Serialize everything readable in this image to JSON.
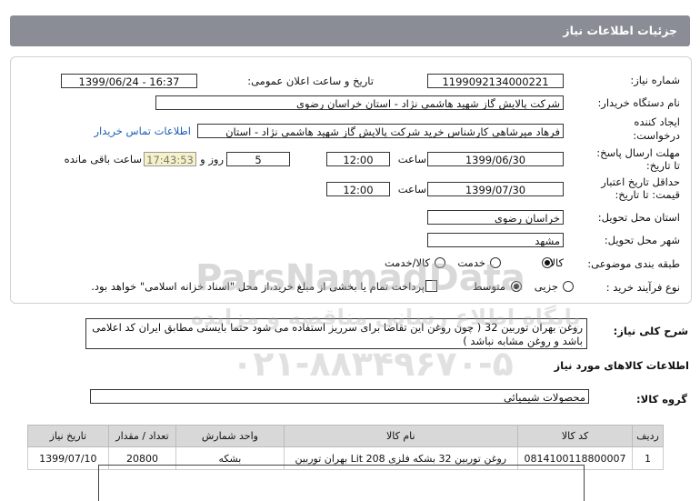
{
  "header": {
    "title": "جزئیات اطلاعات نیاز"
  },
  "form": {
    "need_number": {
      "label": "شماره نیاز:",
      "value": "1199092134000221"
    },
    "announce_datetime": {
      "label": "تاریخ و ساعت اعلان عمومی:",
      "value": "1399/06/24 - 16:37"
    },
    "buyer": {
      "label": "نام دستگاه خریدار:",
      "value": "شرکت پالایش گاز شهید هاشمی نژاد - استان خراسان رضوی"
    },
    "creator": {
      "label1": "ایجاد کننده",
      "label2": "درخواست:",
      "value": "فرهاد میرشاهی کارشناس خرید شرکت پالایش گاز شهید هاشمی نژاد - استان",
      "contact_link": "اطلاعات تماس خریدار"
    },
    "reply_deadline": {
      "label1": "مهلت ارسال پاسخ:",
      "label2": "تا تاریخ:",
      "date": "1399/06/30",
      "time_label": "ساعت",
      "time": "12:00",
      "days": "5",
      "days_label": "روز و",
      "remaining": "17:43:53",
      "remaining_label": "ساعت باقی مانده"
    },
    "price_validity": {
      "label1": "حداقل تاریخ اعتبار",
      "label2": "قیمت: تا تاریخ:",
      "date": "1399/07/30",
      "time_label": "ساعت",
      "time": "12:00"
    },
    "delivery_province": {
      "label": "استان محل تحویل:",
      "value": "خراسان رضوی"
    },
    "delivery_city": {
      "label": "شهر محل تحویل:",
      "value": "مشهد"
    },
    "category": {
      "label": "طبقه بندی موضوعی:",
      "options": [
        "کالا",
        "خدمت",
        "کالا/خدمت"
      ],
      "selected": "کالا"
    },
    "purchase_process": {
      "label": "نوع فرآیند خرید :",
      "options": [
        "جزیی",
        "متوسط"
      ],
      "selected": "متوسط",
      "checkbox_text": "پرداخت تمام یا بخشی از مبلغ خرید،از محل \"اسناد خزانه اسلامی\" خواهد بود."
    }
  },
  "description": {
    "label": "شرح کلی نیاز:",
    "text": "روغن بهران توربین 32 ( چون روغن این تقاضا برای سرریز استفاده می شود حتما بایستی مطابق ایران کد اعلامی باشد و روغن مشابه نباشد )"
  },
  "goods_info": {
    "title": "اطلاعات کالاهای مورد نیاز",
    "group_label": "گروه کالا:",
    "group_value": "محصولات شیمیائی",
    "columns": [
      "ردیف",
      "کد کالا",
      "نام کالا",
      "واحد شمارش",
      "تعداد / مقدار",
      "تاریخ نیاز"
    ],
    "rows": [
      {
        "row": "1",
        "code": "0814100118800007",
        "name": "روغن توربین 32 بشکه فلزی 208 Lit بهران توربین",
        "unit": "بشکه",
        "qty": "20800",
        "date": "1399/07/10"
      }
    ]
  },
  "watermark": {
    "brand": "ParsNamadData",
    "tagline": "پایگاه اطلاع رسانی مناقصه و مزایده",
    "phone": "۰۲۱-۸۸۳۴۹۶۷۰-۵"
  }
}
